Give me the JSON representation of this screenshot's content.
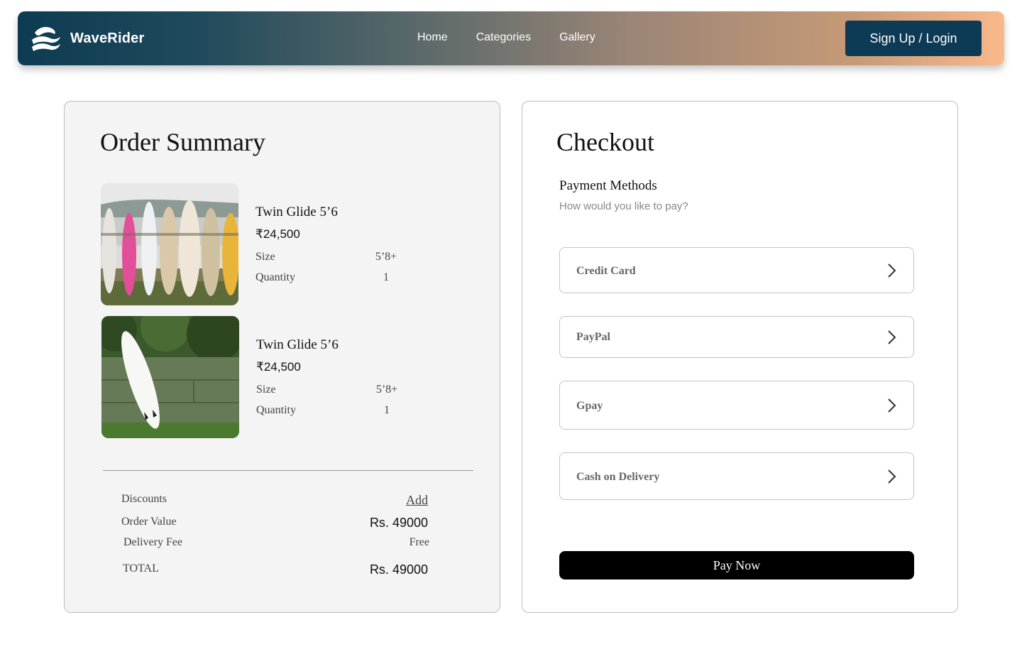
{
  "header": {
    "brand": "WaveRider",
    "nav": [
      "Home",
      "Categories",
      "Gallery"
    ],
    "login_label": "Sign Up / Login",
    "logo_icon": "wave-logo-icon"
  },
  "summary": {
    "title": "Order Summary",
    "items": [
      {
        "name": "Twin Glide 5’6",
        "price": "₹24,500",
        "size_label": "Size",
        "size_value": "5’8+",
        "qty_label": "Quantity",
        "qty_value": "1"
      },
      {
        "name": "Twin Glide 5’6",
        "price": "₹24,500",
        "size_label": "Size",
        "size_value": "5’8+",
        "qty_label": "Quantity",
        "qty_value": "1"
      }
    ],
    "totals": {
      "discounts_label": "Discounts",
      "discounts_action": "Add",
      "order_value_label": "Order Value",
      "order_value": "Rs. 49000",
      "delivery_label": "Delivery Fee",
      "delivery_value": "Free",
      "total_label": "TOTAL",
      "total_value": "Rs. 49000"
    }
  },
  "checkout": {
    "title": "Checkout",
    "payment_title": "Payment Methods",
    "payment_subtitle": "How would you like to pay?",
    "methods": [
      "Credit Card",
      "PayPal",
      "Gpay",
      "Cash on Delivery"
    ],
    "pay_label": "Pay Now"
  }
}
